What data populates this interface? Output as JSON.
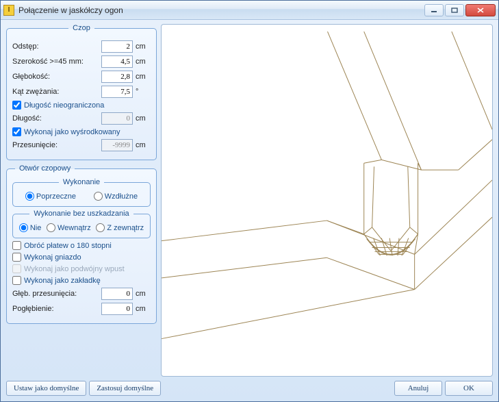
{
  "window": {
    "title": "Połączenie w jaskółczy ogon"
  },
  "czop": {
    "legend": "Czop",
    "odstep_label": "Odstęp:",
    "odstep_value": "2",
    "odstep_unit": "cm",
    "szerokosc_label": "Szerokość >=45 mm:",
    "szerokosc_value": "4,5",
    "szerokosc_unit": "cm",
    "glebokosc_label": "Głębokość:",
    "glebokosc_value": "2,8",
    "glebokosc_unit": "cm",
    "kat_label": "Kąt zwężania:",
    "kat_value": "7,5",
    "kat_unit": "°",
    "nieograniczona_label": "Długość nieograniczona",
    "nieograniczona_checked": true,
    "dlugosc_label": "Długość:",
    "dlugosc_value": "0",
    "dlugosc_unit": "cm",
    "wysrodkowany_label": "Wykonaj jako wyśrodkowany",
    "wysrodkowany_checked": true,
    "przesuniecie_label": "Przesunięcie:",
    "przesuniecie_value": "-9999",
    "przesuniecie_unit": "cm"
  },
  "otwor": {
    "legend": "Otwór czopowy",
    "wykonanie": {
      "legend": "Wykonanie",
      "options": [
        "Poprzeczne",
        "Wzdłużne"
      ],
      "selected": "Poprzeczne"
    },
    "bez_uszkadzania": {
      "legend": "Wykonanie bez uszkadzania",
      "options": [
        "Nie",
        "Wewnątrz",
        "Z zewnątrz"
      ],
      "selected": "Nie"
    },
    "obroc_label": "Obróć płatew o 180 stopni",
    "obroc_checked": false,
    "gniazdo_label": "Wykonaj gniazdo",
    "gniazdo_checked": false,
    "podwojny_label": "Wykonaj jako podwójny wpust",
    "podwojny_checked": false,
    "podwojny_disabled": true,
    "zakladka_label": "Wykonaj jako zakładkę",
    "zakladka_checked": false,
    "gleb_przes_label": "Głęb. przesunięcia:",
    "gleb_przes_value": "0",
    "gleb_przes_unit": "cm",
    "poglebienie_label": "Pogłębienie:",
    "poglebienie_value": "0",
    "poglebienie_unit": "cm"
  },
  "buttons": {
    "set_default": "Ustaw jako domyślne",
    "apply_default": "Zastosuj domyślne",
    "cancel": "Anuluj",
    "ok": "OK"
  }
}
